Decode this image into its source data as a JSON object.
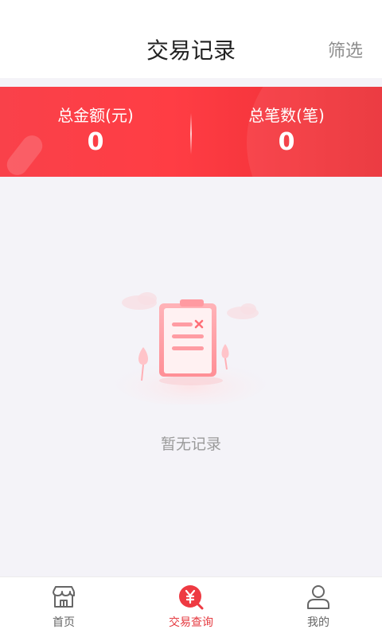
{
  "header": {
    "title": "交易记录",
    "filter_label": "筛选"
  },
  "summary": {
    "total_amount_label": "总金额(元)",
    "total_amount_value": "0",
    "total_count_label": "总笔数(笔)",
    "total_count_value": "0"
  },
  "empty_state": {
    "message": "暂无记录",
    "icon": "empty-clipboard-icon"
  },
  "bottom_nav": {
    "items": [
      {
        "label": "首页",
        "icon": "store-icon",
        "active": false
      },
      {
        "label": "交易查询",
        "icon": "yen-search-icon",
        "active": true
      },
      {
        "label": "我的",
        "icon": "user-icon",
        "active": false
      }
    ]
  },
  "colors": {
    "accent": "#e53a40",
    "banner": "#f9414a",
    "background": "#f4f3f8"
  }
}
